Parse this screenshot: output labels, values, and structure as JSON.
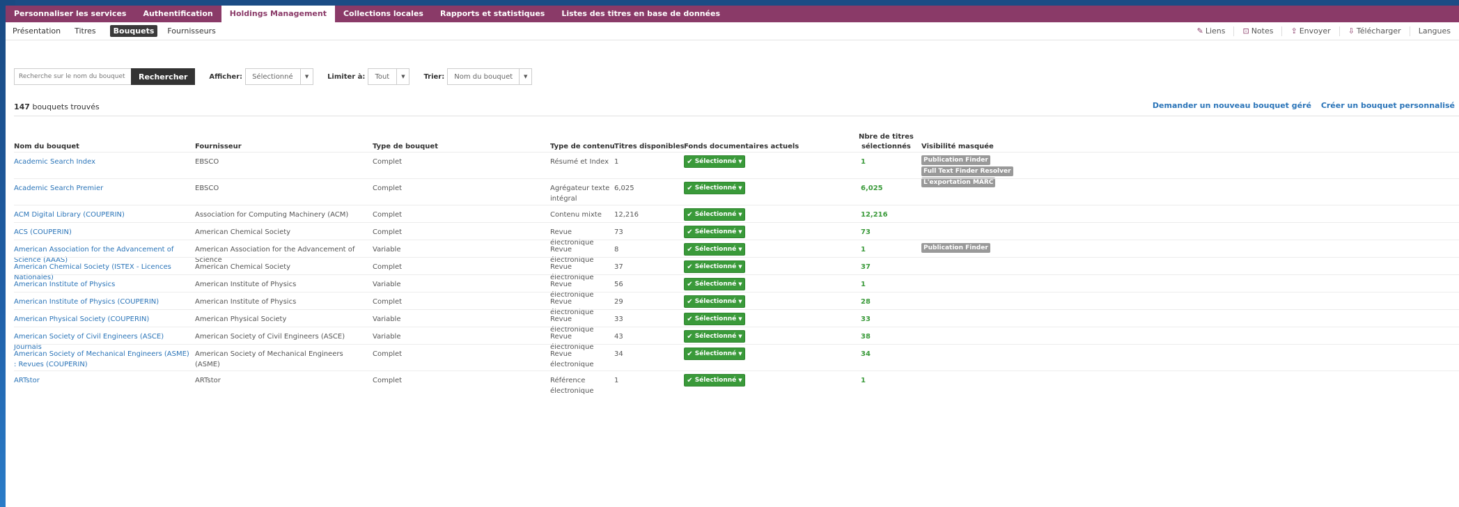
{
  "tabs": [
    {
      "label": "Personnaliser les services",
      "active": false
    },
    {
      "label": "Authentification",
      "active": false
    },
    {
      "label": "Holdings Management",
      "active": true
    },
    {
      "label": "Collections locales",
      "active": false
    },
    {
      "label": "Rapports et statistiques",
      "active": false
    },
    {
      "label": "Listes des titres en base de données",
      "active": false
    }
  ],
  "subnav": {
    "items": [
      {
        "label": "Présentation",
        "active": false
      },
      {
        "label": "Titres",
        "active": false
      },
      {
        "label": "Bouquets",
        "active": true
      },
      {
        "label": "Fournisseurs",
        "active": false
      }
    ],
    "actions": [
      {
        "icon": "link-icon",
        "glyph": "✎",
        "label": "Liens"
      },
      {
        "icon": "notes-icon",
        "glyph": "⊡",
        "label": "Notes"
      },
      {
        "icon": "send-icon",
        "glyph": "⇪",
        "label": "Envoyer"
      },
      {
        "icon": "download-icon",
        "glyph": "⇩",
        "label": "Télécharger"
      },
      {
        "icon": "",
        "glyph": "",
        "label": "Langues"
      }
    ]
  },
  "search": {
    "placeholder": "Recherche sur le nom du bouquet",
    "button": "Rechercher"
  },
  "filters": {
    "show_label": "Afficher:",
    "show_value": "Sélectionné",
    "limit_label": "Limiter à:",
    "limit_value": "Tout",
    "sort_label": "Trier:",
    "sort_value": "Nom du bouquet"
  },
  "results": {
    "count": "147",
    "count_suffix": "bouquets trouvés",
    "link_request": "Demander un nouveau bouquet géré",
    "link_create": "Créer un bouquet personnalisé"
  },
  "columns": {
    "name": "Nom du bouquet",
    "provider": "Fournisseur",
    "type": "Type de bouquet",
    "content": "Type de contenu",
    "available": "Titres disponibles",
    "holdings": "Fonds documentaires actuels",
    "selected_line1": "Nbre de titres",
    "selected_line2": "sélectionnés",
    "visibility": "Visibilité masquée"
  },
  "selected_button_label": "Sélectionné",
  "rows": [
    {
      "name": "Academic Search Index",
      "provider": "EBSCO",
      "type": "Complet",
      "content": "Résumé et Index",
      "available": "1",
      "selected": "1",
      "badges": [
        "Publication Finder",
        "Full Text Finder Resolver",
        "L'exportation MARC"
      ]
    },
    {
      "name": "Academic Search Premier",
      "provider": "EBSCO",
      "type": "Complet",
      "content": "Agrégateur texte intégral",
      "available": "6,025",
      "selected": "6,025",
      "badges": []
    },
    {
      "name": "ACM Digital Library (COUPERIN)",
      "provider": "Association for Computing Machinery (ACM)",
      "type": "Complet",
      "content": "Contenu mixte",
      "available": "12,216",
      "selected": "12,216",
      "badges": []
    },
    {
      "name": "ACS (COUPERIN)",
      "provider": "American Chemical Society",
      "type": "Complet",
      "content": "Revue électronique",
      "available": "73",
      "selected": "73",
      "badges": []
    },
    {
      "name": "American Association for the Advancement of Science (AAAS)",
      "provider": "American Association for the Advancement of Science",
      "type": "Variable",
      "content": "Revue électronique",
      "available": "8",
      "selected": "1",
      "badges": [
        "Publication Finder"
      ]
    },
    {
      "name": "American Chemical Society (ISTEX - Licences Nationales)",
      "provider": "American Chemical Society",
      "type": "Complet",
      "content": "Revue électronique",
      "available": "37",
      "selected": "37",
      "badges": []
    },
    {
      "name": "American Institute of Physics",
      "provider": "American Institute of Physics",
      "type": "Variable",
      "content": "Revue électronique",
      "available": "56",
      "selected": "1",
      "badges": []
    },
    {
      "name": "American Institute of Physics (COUPERIN)",
      "provider": "American Institute of Physics",
      "type": "Complet",
      "content": "Revue électronique",
      "available": "29",
      "selected": "28",
      "badges": []
    },
    {
      "name": "American Physical Society (COUPERIN)",
      "provider": "American Physical Society",
      "type": "Variable",
      "content": "Revue électronique",
      "available": "33",
      "selected": "33",
      "badges": []
    },
    {
      "name": "American Society of Civil Engineers (ASCE) Journals",
      "provider": "American Society of Civil Engineers (ASCE)",
      "type": "Variable",
      "content": "Revue électronique",
      "available": "43",
      "selected": "38",
      "badges": []
    },
    {
      "name": "American Society of Mechanical Engineers (ASME) : Revues (COUPERIN)",
      "provider": "American Society of Mechanical Engineers (ASME)",
      "type": "Complet",
      "content": "Revue électronique",
      "available": "34",
      "selected": "34",
      "badges": []
    },
    {
      "name": "ARTstor",
      "provider": "ARTstor",
      "type": "Complet",
      "content": "Référence électronique",
      "available": "1",
      "selected": "1",
      "badges": []
    }
  ]
}
